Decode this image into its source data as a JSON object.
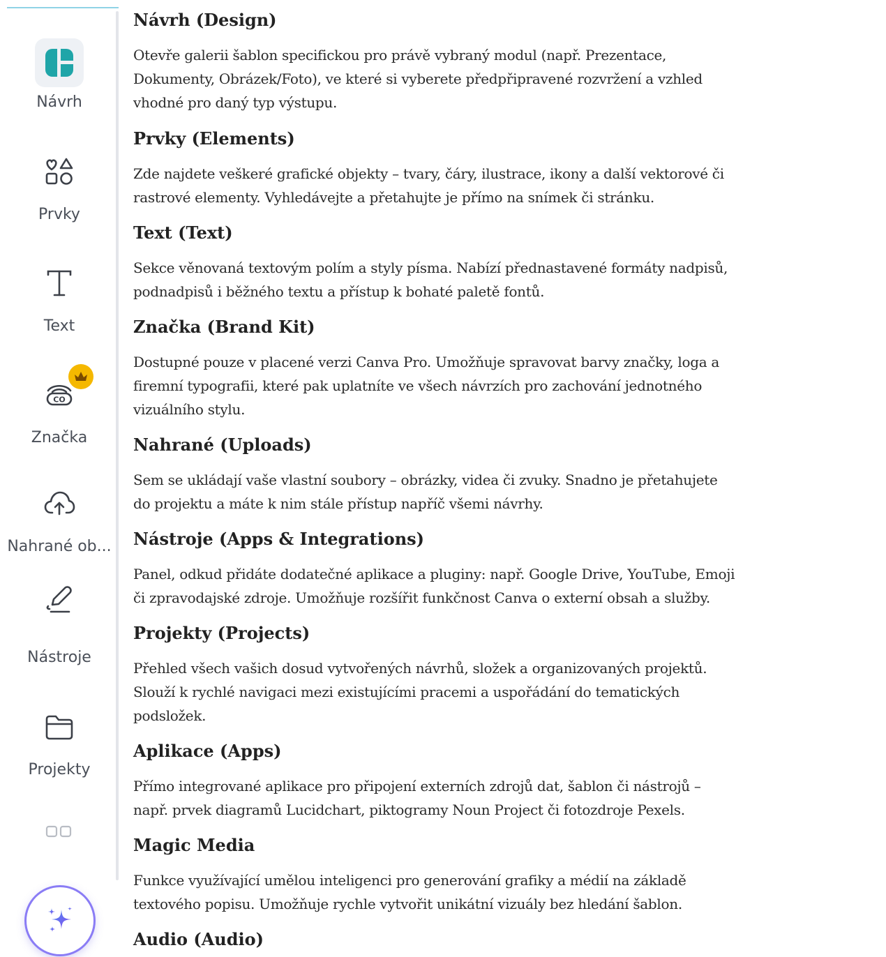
{
  "sidebar": {
    "items": [
      {
        "label": "Návrh",
        "icon": "design-template-icon",
        "active": true
      },
      {
        "label": "Prvky",
        "icon": "shapes-elements-icon"
      },
      {
        "label": "Text",
        "icon": "text-t-icon"
      },
      {
        "label": "Značka",
        "icon": "brand-kit-icon",
        "badge": "crown-icon"
      },
      {
        "label": "Nahrané ob...",
        "icon": "cloud-upload-icon"
      },
      {
        "label": "Nástroje",
        "icon": "pen-tool-icon"
      },
      {
        "label": "Projekty",
        "icon": "folder-icon"
      },
      {
        "label": "",
        "icon": "apps-grid-icon"
      }
    ],
    "magic_button": {
      "icon": "sparkle-icon"
    },
    "colors": {
      "accent": "#1fa5a8",
      "crown": "#f5b800",
      "magic": "#7b5cf0"
    }
  },
  "sections": [
    {
      "title": "Návrh (Design)",
      "lines": [
        "Otevře galerii šablon specifickou pro právě vybraný modul (např. Prezentace,",
        "Dokumenty, Obrázek/Foto), ve které si vyberete předpřipravené rozvržení a vzhled",
        "vhodné pro daný typ výstupu."
      ]
    },
    {
      "title": "Prvky (Elements)",
      "lines": [
        "Zde najdete veškeré grafické objekty – tvary, čáry, ilustrace, ikony a další vektorové či",
        "rastrové elementy. Vyhledávejte a přetahujte je přímo na snímek či stránku."
      ]
    },
    {
      "title": "Text (Text)",
      "lines": [
        "Sekce věnovaná textovým polím a styly písma. Nabízí přednastavené formáty nadpisů,",
        "podnadpisů i běžného textu a přístup k bohaté paletě fontů."
      ]
    },
    {
      "title": "Značka (Brand Kit)",
      "lines": [
        "Dostupné pouze v placené verzi Canva Pro. Umožňuje spravovat barvy značky, loga a",
        "firemní typografii, které pak uplatníte ve všech návrzích pro zachování jednotného",
        "vizuálního stylu."
      ]
    },
    {
      "title": "Nahrané (Uploads)",
      "lines": [
        "Sem se ukládají vaše vlastní soubory – obrázky, videa či zvuky. Snadno je přetahujete",
        "do projektu a máte k nim stále přístup napříč všemi návrhy."
      ]
    },
    {
      "title": "Nástroje (Apps & Integrations)",
      "lines": [
        "Panel, odkud přidáte dodatečné aplikace a pluginy: např. Google Drive, YouTube, Emoji",
        "či zpravodajské zdroje. Umožňuje rozšířit funkčnost Canva o externí obsah a služby."
      ]
    },
    {
      "title": "Projekty (Projects)",
      "lines": [
        "Přehled všech vašich dosud vytvořených návrhů, složek a organizovaných projektů.",
        "Slouží k rychlé navigaci mezi existujícími pracemi a uspořádání do tematických",
        "podsložek."
      ]
    },
    {
      "title": "Aplikace (Apps)",
      "lines": [
        "Přímo integrované aplikace pro připojení externích zdrojů dat, šablon či nástrojů –",
        "např. prvek diagramů Lucidchart, piktogramy Noun Project či fotozdroje Pexels."
      ]
    },
    {
      "title": "Magic Media",
      "lines": [
        "Funkce využívající umělou inteligenci pro generování grafiky a médií na základě",
        "textového popisu. Umožňuje rychle vytvořit unikátní vizuály bez hledání šablon."
      ]
    },
    {
      "title": "Audio (Audio)",
      "lines": []
    }
  ]
}
